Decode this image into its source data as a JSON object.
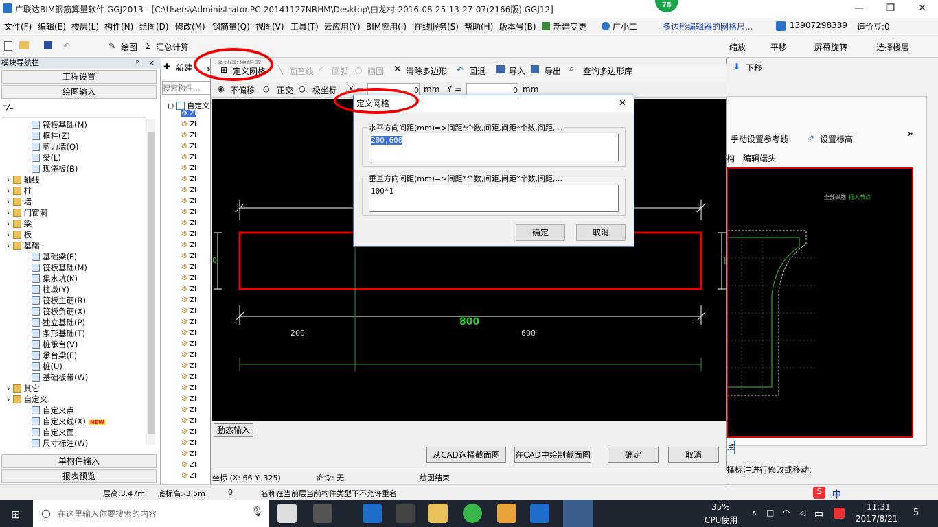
{
  "titlebar": {
    "title": "广联达BIM钢筋算量软件 GGJ2013 - [C:\\Users\\Administrator.PC-20141127NRHM\\Desktop\\白龙村-2016-08-25-13-27-07(2166版).GGJ12]",
    "badge": "75",
    "minimize": "—",
    "restore": "❐",
    "close": "✕"
  },
  "menubar": {
    "items": [
      "文件(F)",
      "编辑(E)",
      "楼层(L)",
      "构件(N)",
      "绘图(D)",
      "修改(M)",
      "钢筋量(Q)",
      "视图(V)",
      "工具(T)",
      "云应用(Y)",
      "BIM应用(I)",
      "在线服务(S)",
      "帮助(H)",
      "版本号(B)"
    ],
    "new_change": "新建变更",
    "helper": "广小二",
    "notice": "多边形编辑器的网格尺...",
    "phone": "13907298339",
    "cost_beans": "造价豆:0"
  },
  "toolbar": {
    "draw": "绘图",
    "sum_calc": "汇总计算",
    "zoom": "缩放",
    "pan": "平移",
    "screen_rotate": "屏幕旋转",
    "select_floor": "选择楼层",
    "move_down": "下移"
  },
  "nav": {
    "header": "模块导航栏",
    "pin": "ᵖ",
    "close": "×",
    "project_settings": "工程设置",
    "drawing_input": "绘图输入",
    "single_input": "单构件输入",
    "report_preview": "报表预览",
    "tree": [
      {
        "label": "筏板基础(M)",
        "level": 2,
        "type": "item"
      },
      {
        "label": "框柱(Z)",
        "level": 2,
        "type": "item"
      },
      {
        "label": "剪力墙(Q)",
        "level": 2,
        "type": "item"
      },
      {
        "label": "梁(L)",
        "level": 2,
        "type": "item"
      },
      {
        "label": "现浇板(B)",
        "level": 2,
        "type": "item"
      },
      {
        "label": "轴线",
        "level": 1,
        "type": "folder"
      },
      {
        "label": "柱",
        "level": 1,
        "type": "folder"
      },
      {
        "label": "墙",
        "level": 1,
        "type": "folder"
      },
      {
        "label": "门窗洞",
        "level": 1,
        "type": "folder"
      },
      {
        "label": "梁",
        "level": 1,
        "type": "folder"
      },
      {
        "label": "板",
        "level": 1,
        "type": "folder"
      },
      {
        "label": "基础",
        "level": 1,
        "type": "folder"
      },
      {
        "label": "基础梁(F)",
        "level": 2,
        "type": "item"
      },
      {
        "label": "筏板基础(M)",
        "level": 2,
        "type": "item"
      },
      {
        "label": "集水坑(K)",
        "level": 2,
        "type": "item"
      },
      {
        "label": "柱墩(Y)",
        "level": 2,
        "type": "item"
      },
      {
        "label": "筏板主筋(R)",
        "level": 2,
        "type": "item"
      },
      {
        "label": "筏板负筋(X)",
        "level": 2,
        "type": "item"
      },
      {
        "label": "独立基础(P)",
        "level": 2,
        "type": "item"
      },
      {
        "label": "条形基础(T)",
        "level": 2,
        "type": "item"
      },
      {
        "label": "桩承台(V)",
        "level": 2,
        "type": "item"
      },
      {
        "label": "承台梁(F)",
        "level": 2,
        "type": "item"
      },
      {
        "label": "桩(U)",
        "level": 2,
        "type": "item"
      },
      {
        "label": "基础板带(W)",
        "level": 2,
        "type": "item"
      },
      {
        "label": "其它",
        "level": 1,
        "type": "folder"
      },
      {
        "label": "自定义",
        "level": 1,
        "type": "folder"
      },
      {
        "label": "自定义点",
        "level": 2,
        "type": "item"
      },
      {
        "label": "自定义线(X)",
        "level": 2,
        "type": "item"
      },
      {
        "label": "自定义面",
        "level": 2,
        "type": "item"
      },
      {
        "label": "尺寸标注(W)",
        "level": 2,
        "type": "item"
      }
    ],
    "new_tag": "NEW"
  },
  "second_panel": {
    "new_btn": "新建",
    "search_placeholder": "搜索构件...",
    "root": "自定义",
    "item_prefix": "ZI"
  },
  "polygon_editor": {
    "title": "多边形编辑器",
    "define_grid": "定义网格",
    "draw_line": "画直线",
    "draw_arc": "画弧",
    "draw_circle": "画圆",
    "clear_polygon": "清除多边形",
    "undo": "回退",
    "import": "导入",
    "export": "导出",
    "query_lib": "查询多边形库",
    "opt_none": "不偏移",
    "opt_ortho": "正交",
    "opt_polar": "极坐标",
    "x_label": "X =",
    "x_value": "0",
    "y_label": "Y =",
    "y_value": "0",
    "unit": "mm",
    "dim_total": "800",
    "dim_left": "200",
    "dim_right": "600",
    "left_marker": "0",
    "right_marker": "]",
    "dynamic_input": "動态输入",
    "btn_from_cad": "从CAD选择截面图",
    "btn_draw_cad": "在CAD中绘制截面图",
    "btn_ok": "确定",
    "btn_cancel": "取消",
    "coord_label": "坐标 (X: 66 Y: 325)",
    "command": "命令: 无",
    "status": "绘图结束"
  },
  "grid_dialog": {
    "title": "定义网格",
    "close": "✕",
    "h_label": "水平方向间距(mm)=>间距*个数,间距,间距*个数,间距,...",
    "h_value": "200,600",
    "v_label": "垂直方向间距(mm)=>间距*个数,间距,间距*个数,间距,...",
    "v_value": "100*1",
    "ok": "确定",
    "cancel": "取消"
  },
  "right_panel": {
    "manual_ref": "手动设置参考线",
    "set_elev": "设置标高",
    "structure": "构",
    "edit_end": "编辑端头",
    "all_long": "全部纵筋",
    "insert_node": "插入节点",
    "bottom_hint": "择标注进行修改或移动;",
    "point_btn": "点"
  },
  "bottombar": {
    "floor_height": "层高:3.47m",
    "bottom_elev": "底标高:-3.5m",
    "zero": "0",
    "message": "名称在当前层当前构件类型下不允许重名",
    "ime": "中"
  },
  "taskbar": {
    "search_placeholder": "在这里输入你要搜索的内容",
    "cpu_percent": "35%",
    "cpu_label": "CPU使用",
    "ime": "中",
    "time": "11:31",
    "date": "2017/8/21",
    "notif": "5"
  }
}
